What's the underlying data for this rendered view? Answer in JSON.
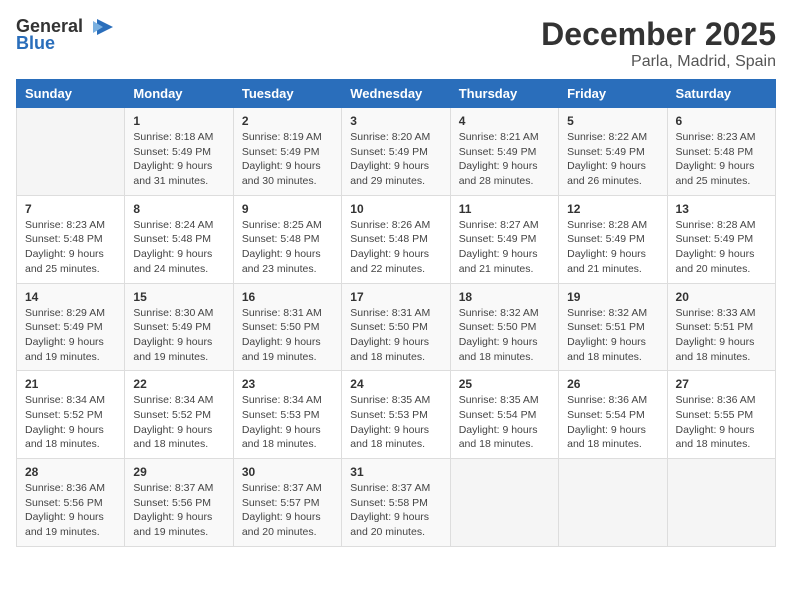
{
  "logo": {
    "general": "General",
    "blue": "Blue"
  },
  "title": "December 2025",
  "location": "Parla, Madrid, Spain",
  "days_of_week": [
    "Sunday",
    "Monday",
    "Tuesday",
    "Wednesday",
    "Thursday",
    "Friday",
    "Saturday"
  ],
  "weeks": [
    [
      {
        "day": "",
        "info": ""
      },
      {
        "day": "1",
        "info": "Sunrise: 8:18 AM\nSunset: 5:49 PM\nDaylight: 9 hours\nand 31 minutes."
      },
      {
        "day": "2",
        "info": "Sunrise: 8:19 AM\nSunset: 5:49 PM\nDaylight: 9 hours\nand 30 minutes."
      },
      {
        "day": "3",
        "info": "Sunrise: 8:20 AM\nSunset: 5:49 PM\nDaylight: 9 hours\nand 29 minutes."
      },
      {
        "day": "4",
        "info": "Sunrise: 8:21 AM\nSunset: 5:49 PM\nDaylight: 9 hours\nand 28 minutes."
      },
      {
        "day": "5",
        "info": "Sunrise: 8:22 AM\nSunset: 5:49 PM\nDaylight: 9 hours\nand 26 minutes."
      },
      {
        "day": "6",
        "info": "Sunrise: 8:23 AM\nSunset: 5:48 PM\nDaylight: 9 hours\nand 25 minutes."
      }
    ],
    [
      {
        "day": "7",
        "info": "Sunrise: 8:23 AM\nSunset: 5:48 PM\nDaylight: 9 hours\nand 25 minutes."
      },
      {
        "day": "8",
        "info": "Sunrise: 8:24 AM\nSunset: 5:48 PM\nDaylight: 9 hours\nand 24 minutes."
      },
      {
        "day": "9",
        "info": "Sunrise: 8:25 AM\nSunset: 5:48 PM\nDaylight: 9 hours\nand 23 minutes."
      },
      {
        "day": "10",
        "info": "Sunrise: 8:26 AM\nSunset: 5:48 PM\nDaylight: 9 hours\nand 22 minutes."
      },
      {
        "day": "11",
        "info": "Sunrise: 8:27 AM\nSunset: 5:49 PM\nDaylight: 9 hours\nand 21 minutes."
      },
      {
        "day": "12",
        "info": "Sunrise: 8:28 AM\nSunset: 5:49 PM\nDaylight: 9 hours\nand 21 minutes."
      },
      {
        "day": "13",
        "info": "Sunrise: 8:28 AM\nSunset: 5:49 PM\nDaylight: 9 hours\nand 20 minutes."
      }
    ],
    [
      {
        "day": "14",
        "info": "Sunrise: 8:29 AM\nSunset: 5:49 PM\nDaylight: 9 hours\nand 19 minutes."
      },
      {
        "day": "15",
        "info": "Sunrise: 8:30 AM\nSunset: 5:49 PM\nDaylight: 9 hours\nand 19 minutes."
      },
      {
        "day": "16",
        "info": "Sunrise: 8:31 AM\nSunset: 5:50 PM\nDaylight: 9 hours\nand 19 minutes."
      },
      {
        "day": "17",
        "info": "Sunrise: 8:31 AM\nSunset: 5:50 PM\nDaylight: 9 hours\nand 18 minutes."
      },
      {
        "day": "18",
        "info": "Sunrise: 8:32 AM\nSunset: 5:50 PM\nDaylight: 9 hours\nand 18 minutes."
      },
      {
        "day": "19",
        "info": "Sunrise: 8:32 AM\nSunset: 5:51 PM\nDaylight: 9 hours\nand 18 minutes."
      },
      {
        "day": "20",
        "info": "Sunrise: 8:33 AM\nSunset: 5:51 PM\nDaylight: 9 hours\nand 18 minutes."
      }
    ],
    [
      {
        "day": "21",
        "info": "Sunrise: 8:34 AM\nSunset: 5:52 PM\nDaylight: 9 hours\nand 18 minutes."
      },
      {
        "day": "22",
        "info": "Sunrise: 8:34 AM\nSunset: 5:52 PM\nDaylight: 9 hours\nand 18 minutes."
      },
      {
        "day": "23",
        "info": "Sunrise: 8:34 AM\nSunset: 5:53 PM\nDaylight: 9 hours\nand 18 minutes."
      },
      {
        "day": "24",
        "info": "Sunrise: 8:35 AM\nSunset: 5:53 PM\nDaylight: 9 hours\nand 18 minutes."
      },
      {
        "day": "25",
        "info": "Sunrise: 8:35 AM\nSunset: 5:54 PM\nDaylight: 9 hours\nand 18 minutes."
      },
      {
        "day": "26",
        "info": "Sunrise: 8:36 AM\nSunset: 5:54 PM\nDaylight: 9 hours\nand 18 minutes."
      },
      {
        "day": "27",
        "info": "Sunrise: 8:36 AM\nSunset: 5:55 PM\nDaylight: 9 hours\nand 18 minutes."
      }
    ],
    [
      {
        "day": "28",
        "info": "Sunrise: 8:36 AM\nSunset: 5:56 PM\nDaylight: 9 hours\nand 19 minutes."
      },
      {
        "day": "29",
        "info": "Sunrise: 8:37 AM\nSunset: 5:56 PM\nDaylight: 9 hours\nand 19 minutes."
      },
      {
        "day": "30",
        "info": "Sunrise: 8:37 AM\nSunset: 5:57 PM\nDaylight: 9 hours\nand 20 minutes."
      },
      {
        "day": "31",
        "info": "Sunrise: 8:37 AM\nSunset: 5:58 PM\nDaylight: 9 hours\nand 20 minutes."
      },
      {
        "day": "",
        "info": ""
      },
      {
        "day": "",
        "info": ""
      },
      {
        "day": "",
        "info": ""
      }
    ]
  ]
}
